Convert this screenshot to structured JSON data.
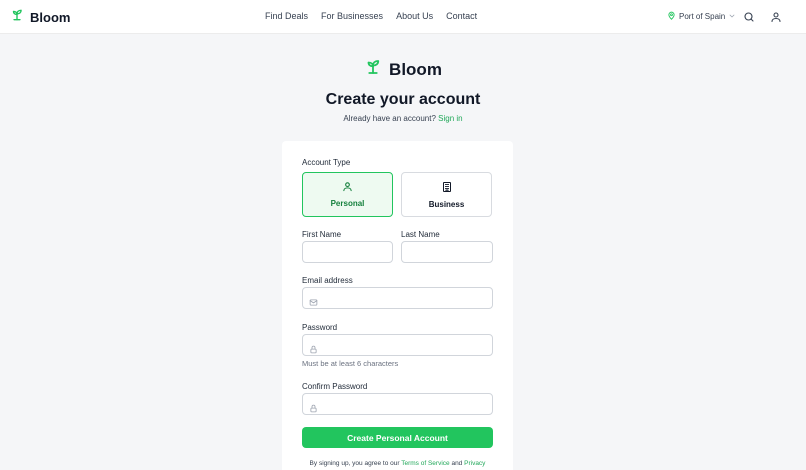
{
  "header": {
    "brand": "Bloom",
    "nav": [
      "Find Deals",
      "For Businesses",
      "About Us",
      "Contact"
    ],
    "location": "Port of Spain"
  },
  "page": {
    "brand": "Bloom",
    "title": "Create your account",
    "signin_prompt": "Already have an account?",
    "signin_link": "Sign in"
  },
  "form": {
    "account_type_label": "Account Type",
    "account_types": [
      {
        "label": "Personal",
        "icon": "person-icon",
        "selected": true
      },
      {
        "label": "Business",
        "icon": "building-icon",
        "selected": false
      }
    ],
    "first_name_label": "First Name",
    "first_name_value": "",
    "last_name_label": "Last Name",
    "last_name_value": "",
    "email_label": "Email address",
    "email_value": "",
    "password_label": "Password",
    "password_value": "",
    "password_hint": "Must be at least 6 characters",
    "confirm_label": "Confirm Password",
    "confirm_value": "",
    "submit_label": "Create Personal Account",
    "terms_prefix": "By signing up, you agree to our",
    "terms_link": "Terms of Service",
    "terms_and": "and",
    "privacy_link": "Privacy"
  },
  "colors": {
    "accent": "#22c55e",
    "accent_dark": "#15803d",
    "link": "#22a85a"
  }
}
